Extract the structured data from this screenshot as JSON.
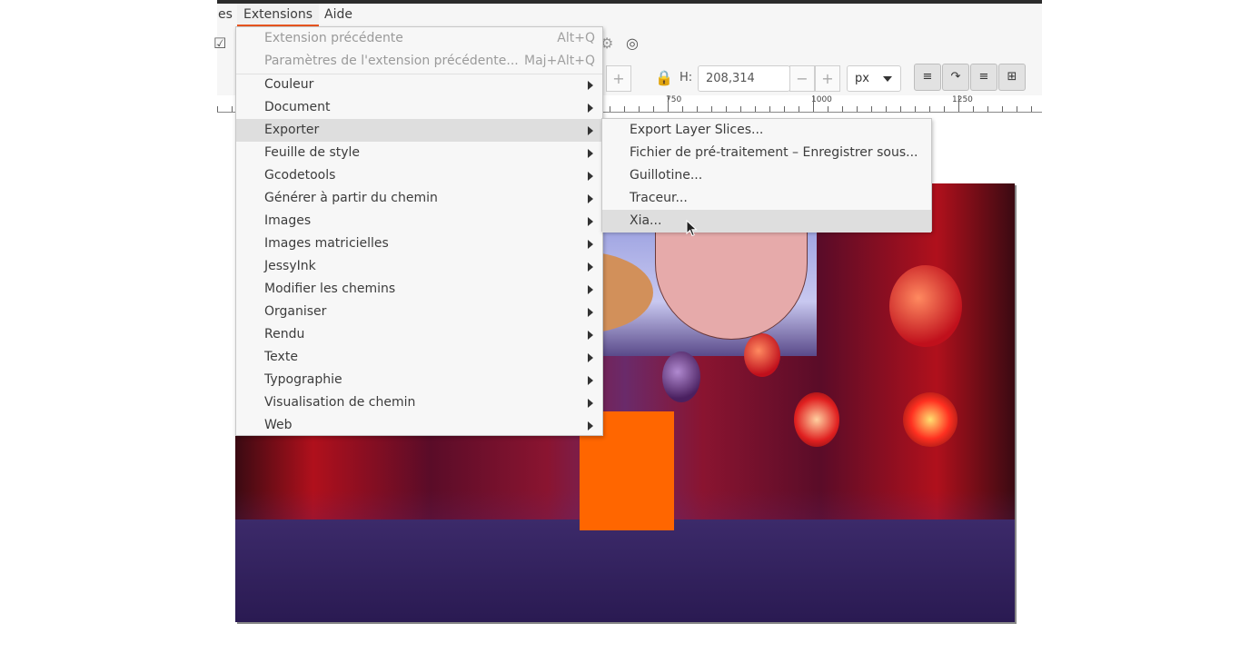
{
  "menubar": {
    "items": [
      {
        "label": "es"
      },
      {
        "label": "Extensions"
      },
      {
        "label": "Aide"
      }
    ]
  },
  "toolbar": {
    "h_label": "H:",
    "h_value": "208,314",
    "minus": "−",
    "plus": "+",
    "unit": "px",
    "lock_icon": "lock-icon"
  },
  "ruler": {
    "labels": [
      "750",
      "1000",
      "1250"
    ]
  },
  "extensions_menu": {
    "items": [
      {
        "label": "Extension précédente",
        "shortcut": "Alt+Q",
        "disabled": true,
        "submenu": false
      },
      {
        "label": "Paramètres de l'extension précédente...",
        "shortcut": "Maj+Alt+Q",
        "disabled": true,
        "submenu": false
      },
      {
        "label": "Couleur",
        "submenu": true
      },
      {
        "label": "Document",
        "submenu": true
      },
      {
        "label": "Exporter",
        "submenu": true,
        "highlighted": true
      },
      {
        "label": "Feuille de style",
        "submenu": true
      },
      {
        "label": "Gcodetools",
        "submenu": true
      },
      {
        "label": "Générer à partir du chemin",
        "submenu": true
      },
      {
        "label": "Images",
        "submenu": true
      },
      {
        "label": "Images matricielles",
        "submenu": true
      },
      {
        "label": "JessyInk",
        "submenu": true
      },
      {
        "label": "Modifier les chemins",
        "submenu": true
      },
      {
        "label": "Organiser",
        "submenu": true
      },
      {
        "label": "Rendu",
        "submenu": true
      },
      {
        "label": "Texte",
        "submenu": true
      },
      {
        "label": "Typographie",
        "submenu": true
      },
      {
        "label": "Visualisation de chemin",
        "submenu": true
      },
      {
        "label": "Web",
        "submenu": true
      }
    ]
  },
  "export_submenu": {
    "items": [
      {
        "label": "Export Layer Slices..."
      },
      {
        "label": "Fichier de pré-traitement – Enregistrer sous..."
      },
      {
        "label": "Guillotine..."
      },
      {
        "label": "Traceur..."
      },
      {
        "label": "Xia...",
        "highlighted": true
      }
    ]
  },
  "colors": {
    "accent": "#e95420",
    "menu_bg": "#f7f7f7",
    "highlight": "#dedede",
    "orange_rect": "#ff6600",
    "tan_ellipse": "#d2905a",
    "pink_shape": "#e6aaaa"
  }
}
